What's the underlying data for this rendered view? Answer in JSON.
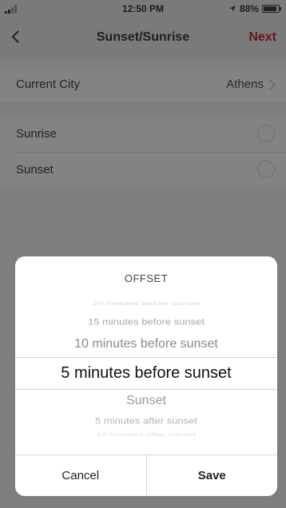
{
  "status_bar": {
    "time": "12:50 PM",
    "battery_text": "88%",
    "battery_level": 0.88,
    "location_icon": "location-arrow-icon"
  },
  "nav": {
    "back_icon": "chevron-left-icon",
    "title": "Sunset/Sunrise",
    "next_label": "Next"
  },
  "settings": {
    "current_city_label": "Current City",
    "current_city_value": "Athens",
    "sunrise_label": "Sunrise",
    "sunset_label": "Sunset"
  },
  "modal": {
    "heading": "OFFSET",
    "options": [
      "20 minutes before sunset",
      "15 minutes before sunset",
      "10 minutes before sunset",
      "5 minutes before sunset",
      "Sunset",
      "5 minutes after sunset",
      "10 minutes after sunset"
    ],
    "selected_index": 3,
    "cancel_label": "Cancel",
    "save_label": "Save"
  },
  "colors": {
    "accent": "#D0021B",
    "overlay": "#7e7e7e"
  }
}
